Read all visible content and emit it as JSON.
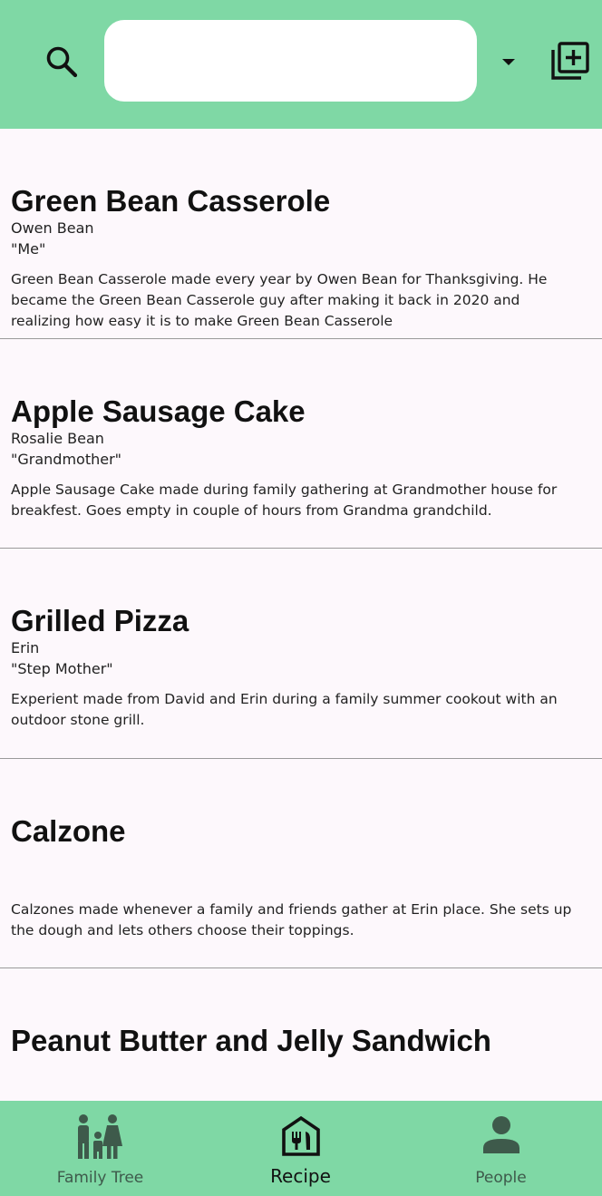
{
  "header": {
    "search_value": "",
    "search_placeholder": "",
    "accent_color": "#7fd8a5",
    "icons": [
      "search-icon",
      "dropdown-arrow-icon",
      "add-recipe-icon"
    ]
  },
  "recipes": [
    {
      "title": "Green Bean Casserole",
      "author": "Owen Bean",
      "relation": "\"Me\"",
      "description": "Green Bean Casserole made every year by Owen Bean for Thanksgiving. He became the Green Bean Casserole guy after making it back in 2020 and realizing how easy it is to make Green Bean Casserole"
    },
    {
      "title": "Apple Sausage Cake",
      "author": "Rosalie Bean",
      "relation": "\"Grandmother\"",
      "description": "Apple Sausage Cake made during family gathering at Grandmother house for breakfest. Goes empty in couple of hours from Grandma grandchild."
    },
    {
      "title": "Grilled Pizza",
      "author": "Erin",
      "relation": "\"Step Mother\"",
      "description": "Experient made from David and Erin during a family summer cookout with an outdoor stone grill."
    },
    {
      "title": "Calzone",
      "author": "",
      "relation": "",
      "description": "Calzones made whenever a family and friends gather at Erin place. She sets up the dough and lets others choose their toppings."
    },
    {
      "title": "Peanut Butter and Jelly Sandwich",
      "author": "",
      "relation": "",
      "description": ""
    }
  ],
  "bottom_nav": {
    "items": [
      {
        "label": "Family Tree",
        "icon": "family-icon",
        "selected": false
      },
      {
        "label": "Recipe",
        "icon": "recipe-icon",
        "selected": true
      },
      {
        "label": "People",
        "icon": "person-icon",
        "selected": false
      }
    ]
  }
}
